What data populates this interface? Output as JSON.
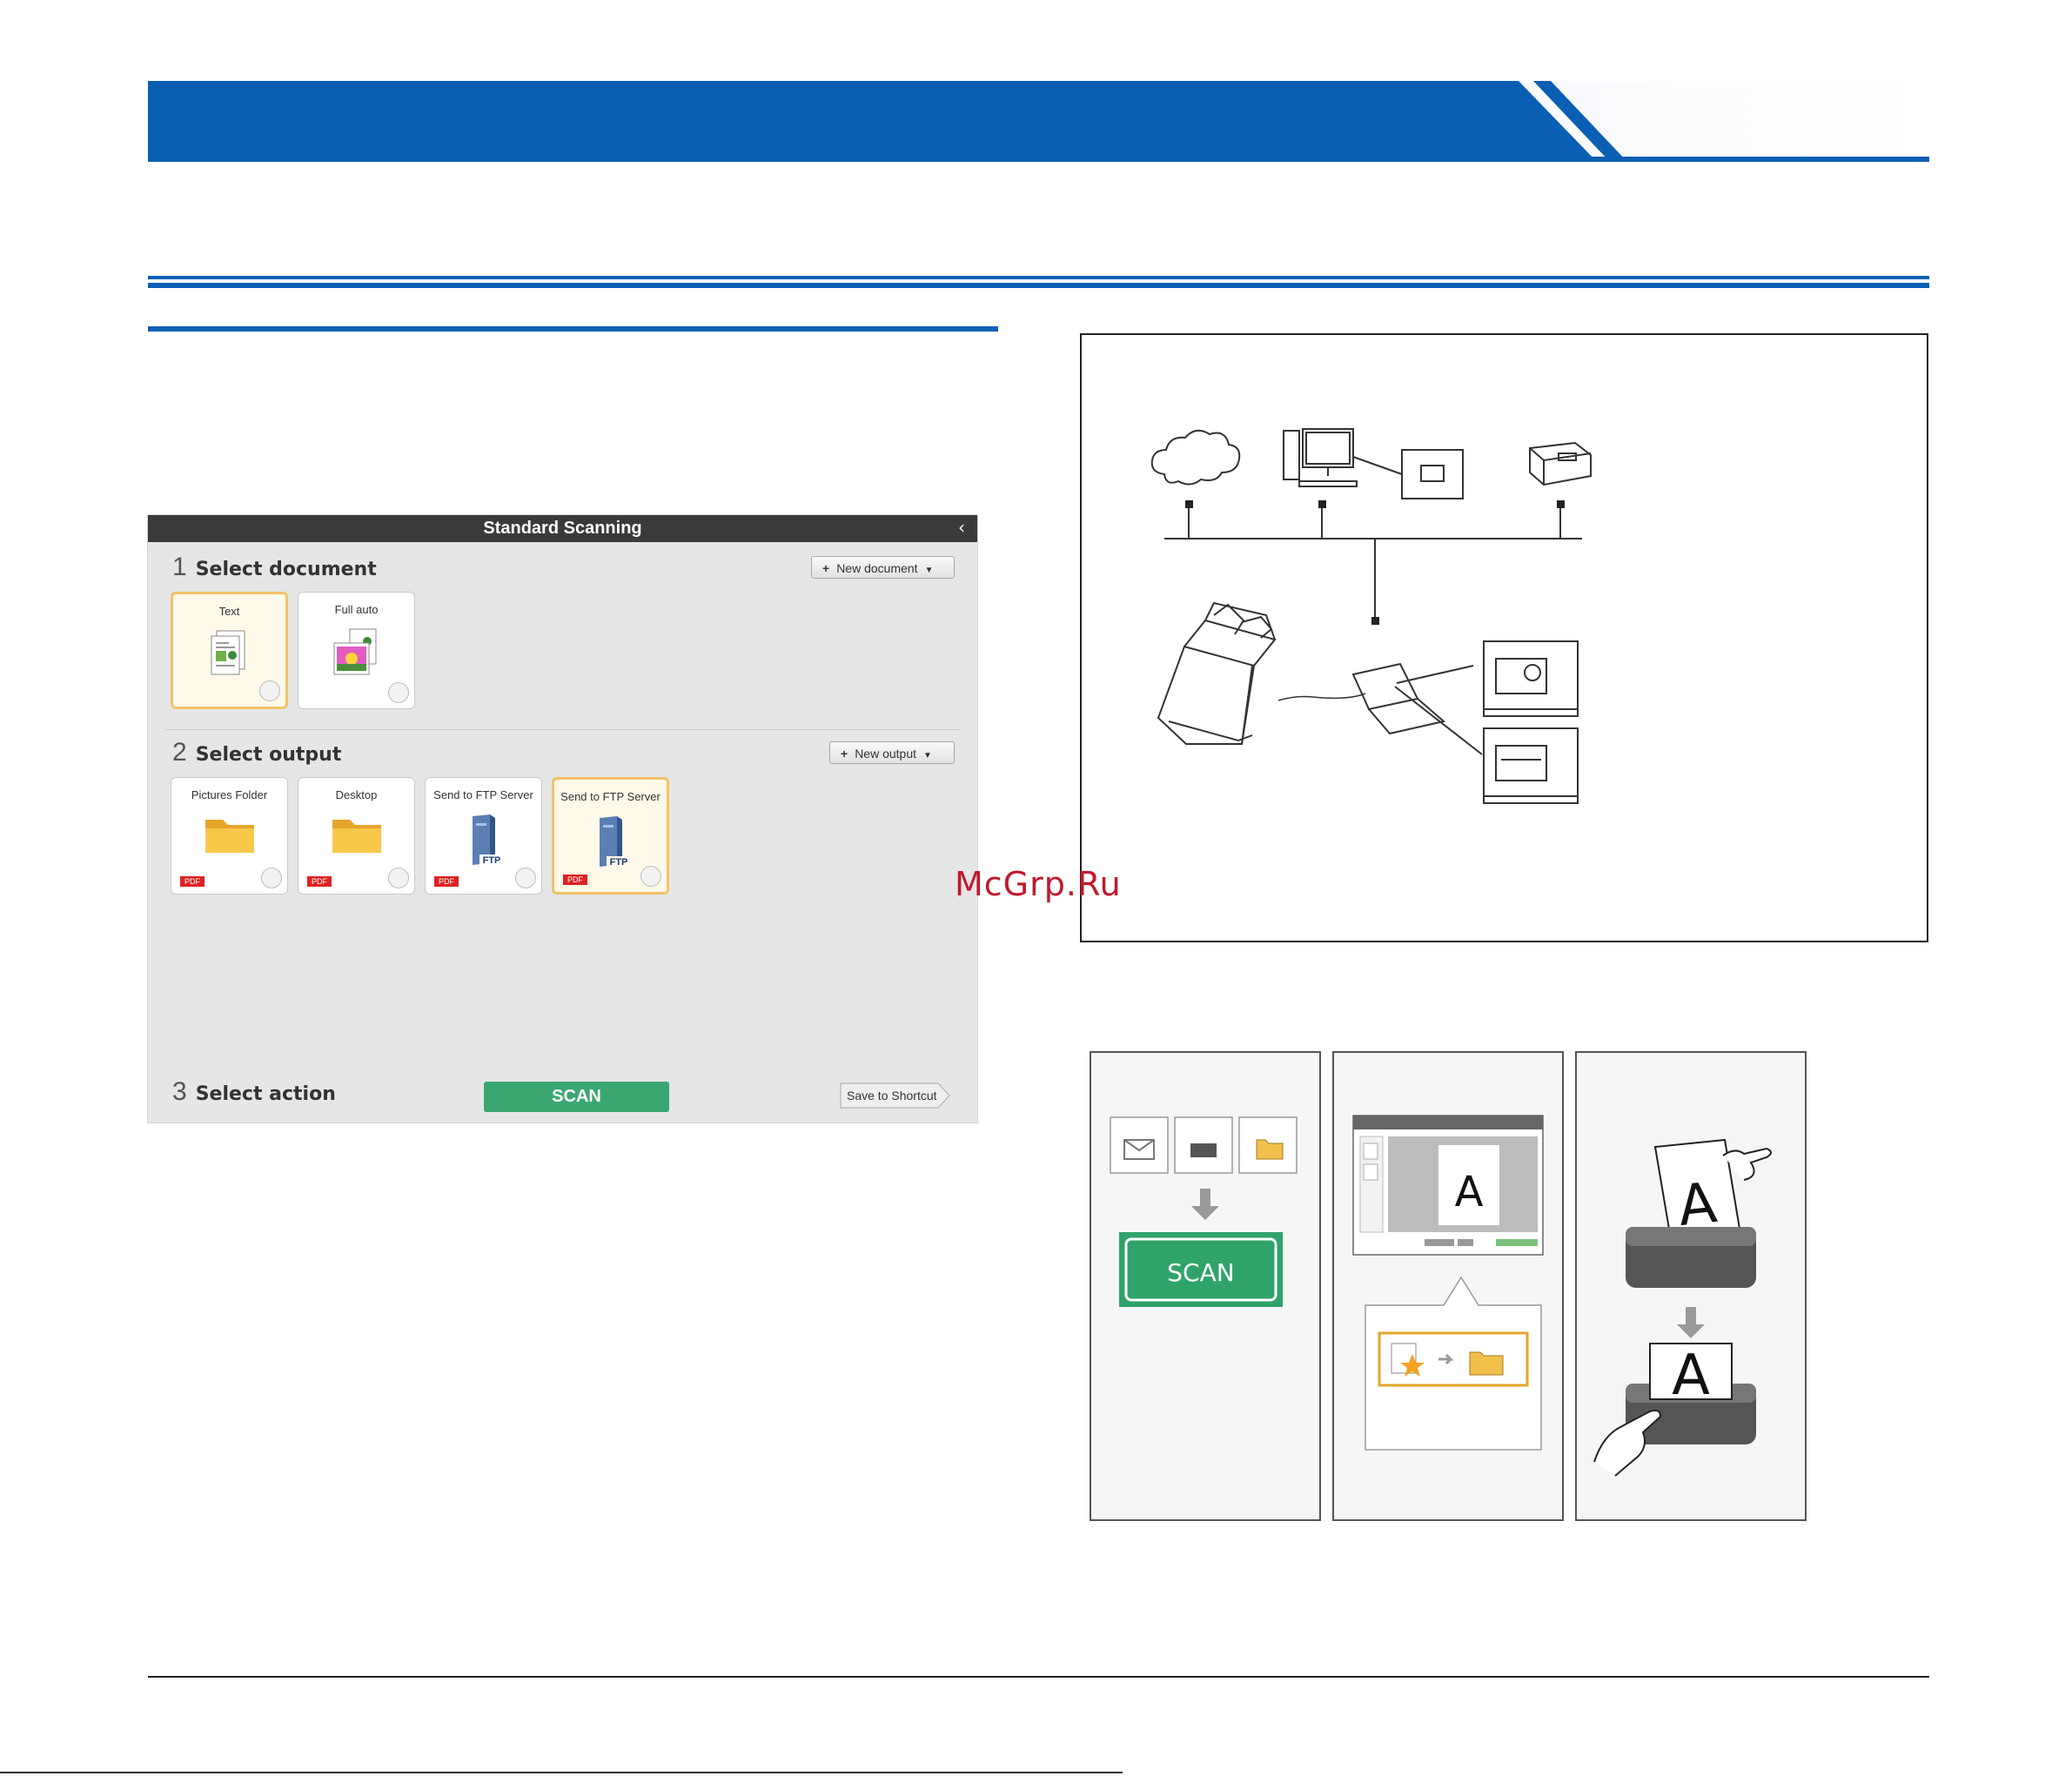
{
  "app": {
    "title": "Standard Scanning",
    "collapse_glyph": "‹",
    "section1": {
      "number": "1",
      "label": "Select document",
      "new_button": "New document"
    },
    "documents": [
      {
        "label": "Text",
        "selected": true,
        "icon": "text-document-icon"
      },
      {
        "label": "Full auto",
        "selected": false,
        "icon": "photo-document-icon"
      }
    ],
    "section2": {
      "number": "2",
      "label": "Select output",
      "new_button": "New output"
    },
    "outputs": [
      {
        "label": "Pictures Folder",
        "badge": "PDF",
        "icon": "folder-icon",
        "selected": false
      },
      {
        "label": "Desktop",
        "badge": "PDF",
        "icon": "folder-icon",
        "selected": false
      },
      {
        "label": "Send to FTP Server",
        "badge": "PDF",
        "icon": "ftp-server-icon",
        "selected": false
      },
      {
        "label": "Send to FTP Server",
        "badge": "PDF",
        "icon": "ftp-server-icon",
        "selected": true
      }
    ],
    "section3": {
      "number": "3",
      "label": "Select action"
    },
    "scan_button": "SCAN",
    "shortcut_button": "Save to Shortcut"
  },
  "flow": {
    "scan_label": "SCAN",
    "preview_letter": "A",
    "paper_letter": "A"
  },
  "watermark": "McGrp.Ru",
  "colors": {
    "brand_blue": "#0a5fb4",
    "scan_green": "#3aa772",
    "selected_border": "#f3c266",
    "title_bar": "#3a3a3a"
  }
}
